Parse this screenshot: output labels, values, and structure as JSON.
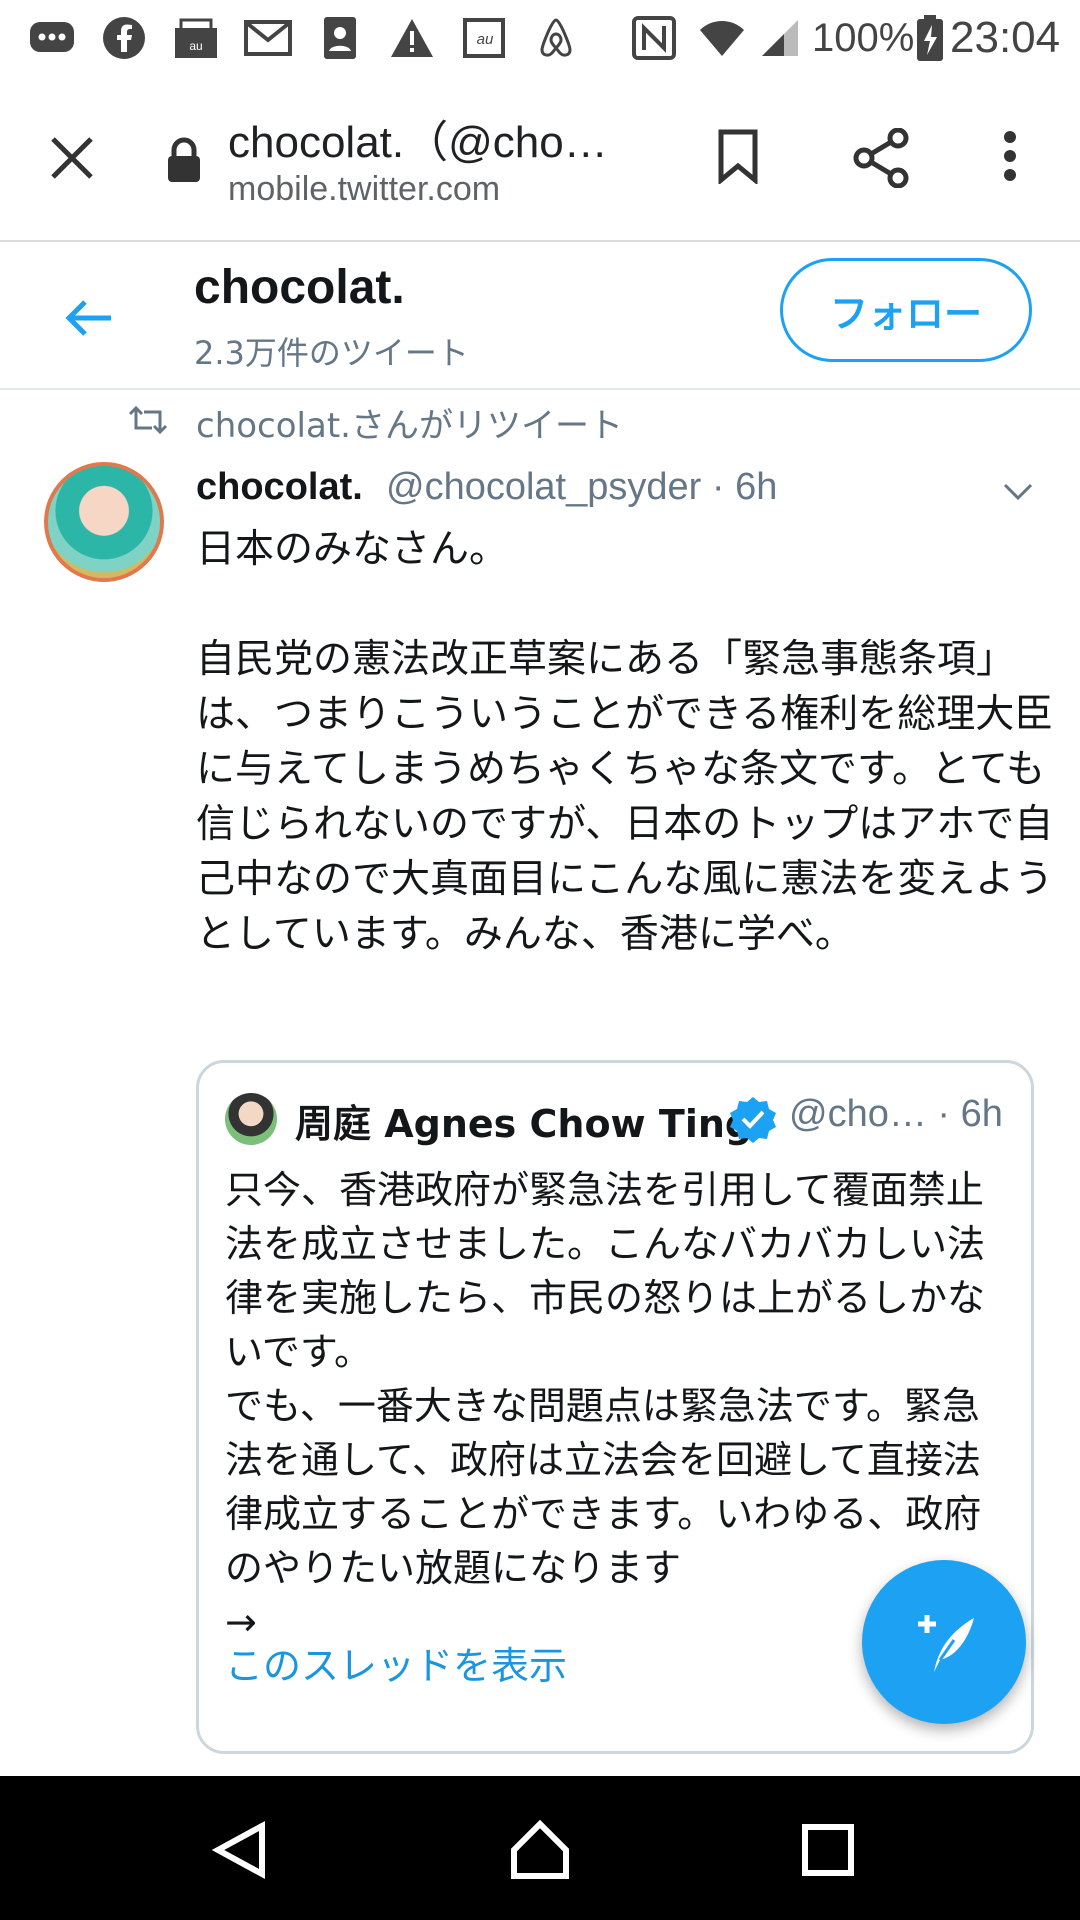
{
  "status_bar": {
    "battery": "100%",
    "time": "23:04",
    "icons": [
      "messages-icon",
      "facebook-icon",
      "mail-icon",
      "gmail-icon",
      "contacts-icon",
      "warning-icon",
      "au-icon",
      "airbnb-icon",
      "nfc-icon",
      "wifi-icon",
      "signal-icon",
      "battery-charging-icon"
    ]
  },
  "browser": {
    "title": "chocolat.（@cho…",
    "url": "mobile.twitter.com"
  },
  "profile_header": {
    "name": "chocolat.",
    "tweet_count": "2.3万件のツイート",
    "follow_label": "フォロー"
  },
  "tweet": {
    "retweet_label": "chocolat.さんがリツイート",
    "author_name": "chocolat.",
    "author_handle": "@chocolat_psyder · 6h",
    "text": "日本のみなさん。\n\n自民党の憲法改正草案にある「緊急事態条項」は、つまりこういうことができる権利を総理大臣に与えてしまうめちゃくちゃな条文です。とても信じられないのですが、日本のトップはアホで自己中なので大真面目にこんな風に憲法を変えようとしています。みんな、香港に学べ。",
    "quote": {
      "author_name": "周庭 Agnes Chow Ting",
      "author_handle": "@cho… · 6h",
      "text": "只今、香港政府が緊急法を引用して覆面禁止法を成立させました。こんなバカバカしい法律を実施したら、市民の怒りは上がるしかないです。\nでも、一番大きな問題点は緊急法です。緊急法を通して、政府は立法会を回避して直接法律成立することができます。いわゆる、政府のやりたい放題になります\n→",
      "thread_link": "このスレッドを表示"
    }
  },
  "colors": {
    "accent": "#1da1f2",
    "link": "#1b95e0",
    "secondary_text": "#657786"
  }
}
